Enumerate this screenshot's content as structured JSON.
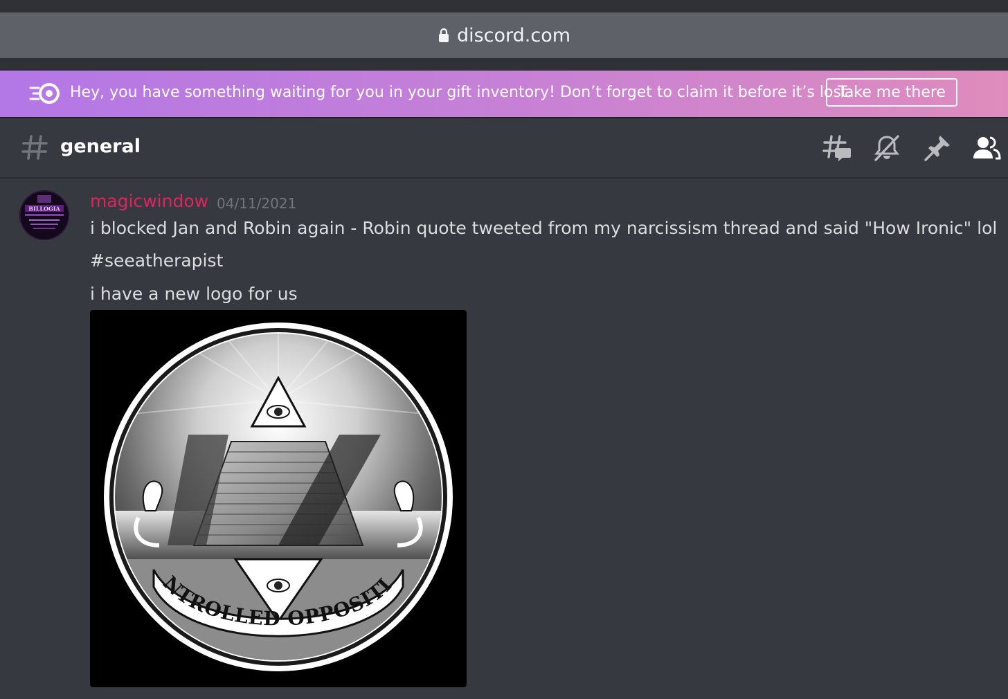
{
  "browser": {
    "url": "discord.com"
  },
  "banner": {
    "message": "Hey, you have something waiting for you in your gift inventory! Don’t forget to claim it before it’s lost.",
    "button_label": "Take me there",
    "icon": "nitro-icon"
  },
  "channel": {
    "name": "general",
    "icons": [
      "threads-icon",
      "mute-bell-icon",
      "pin-icon",
      "members-icon"
    ]
  },
  "message": {
    "author": "magicwindow",
    "author_color": "#e0245e",
    "timestamp": "04/11/2021",
    "lines": [
      "i blocked Jan and Robin again - Robin quote tweeted from my narcissism thread and said \"How Ironic\" lol",
      "#seeatherapist",
      "i have a new logo for us"
    ],
    "attachment": {
      "caption_text": "CONTROLLED OPPOSITION"
    }
  },
  "avatar": {
    "text": "BILLOGIA"
  }
}
